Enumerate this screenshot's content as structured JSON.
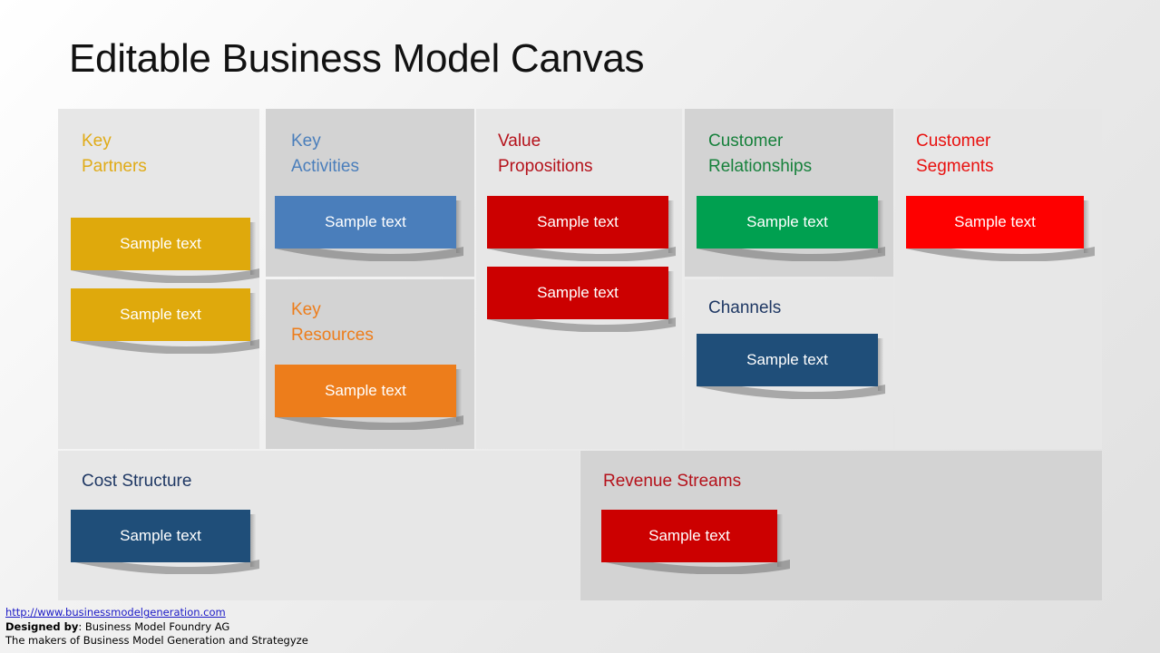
{
  "slide": {
    "title": "Editable Business Model Canvas",
    "note_label": "Sample text"
  },
  "colors": {
    "key_partners": "#dfa90c",
    "key_activities": "#4a7ebb",
    "key_resources": "#ed7d1b",
    "value_propositions": "#cc0000",
    "customer_relationships": "#00a050",
    "channels": "#1f4e79",
    "customer_segments": "#fe0000",
    "cost_structure": "#1f4e79",
    "revenue_streams": "#cc0000",
    "heading_key_partners": "#e0ab17",
    "heading_key_activities": "#4a7ebb",
    "heading_key_resources": "#ed7d1b",
    "heading_value_propositions": "#b5121b",
    "heading_customer_relationships": "#17813c",
    "heading_channels": "#1f3864",
    "heading_customer_segments": "#e8110f",
    "heading_cost_structure": "#1f3864",
    "heading_revenue_streams": "#b5121b",
    "panel_light": "#e7e7e7",
    "panel_dark": "#d3d3d3",
    "link": "#1a18c6"
  },
  "blocks": {
    "key_partners": {
      "heading": "Key\nPartners",
      "notes": [
        "Sample text",
        "Sample text"
      ]
    },
    "key_activities": {
      "heading": "Key\nActivities",
      "notes": [
        "Sample text"
      ]
    },
    "key_resources": {
      "heading": "Key\nResources",
      "notes": [
        "Sample text"
      ]
    },
    "value_propositions": {
      "heading": "Value\nPropositions",
      "notes": [
        "Sample text",
        "Sample text"
      ]
    },
    "customer_relationships": {
      "heading": "Customer\nRelationships",
      "notes": [
        "Sample text"
      ]
    },
    "channels": {
      "heading": "Channels",
      "notes": [
        "Sample text"
      ]
    },
    "customer_segments": {
      "heading": "Customer\nSegments",
      "notes": [
        "Sample text"
      ]
    },
    "cost_structure": {
      "heading": "Cost Structure",
      "notes": [
        "Sample text"
      ]
    },
    "revenue_streams": {
      "heading": "Revenue Streams",
      "notes": [
        "Sample text"
      ]
    }
  },
  "footer": {
    "url": "http://www.businessmodelgeneration.com",
    "designed_label": "Designed by",
    "designed_sep": ": ",
    "designed_value": "Business Model Foundry AG",
    "tagline": "The makers of Business Model Generation and Strategyze"
  }
}
